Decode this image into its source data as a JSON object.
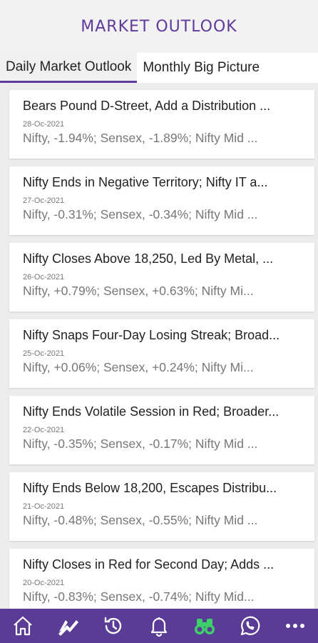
{
  "header": {
    "title": "MARKET OUTLOOK"
  },
  "tabs": [
    {
      "label": "Daily Market Outlook",
      "active": true
    },
    {
      "label": "Monthly Big Picture",
      "active": false
    }
  ],
  "items": [
    {
      "title": "Bears Pound D-Street, Add a Distribution ...",
      "date": "28-Oc-2021",
      "summary": "Nifty, -1.94%; Sensex, -1.89%; Nifty Mid ..."
    },
    {
      "title": "Nifty Ends in Negative Territory; Nifty IT a...",
      "date": "27-Oc-2021",
      "summary": "Nifty, -0.31%; Sensex, -0.34%; Nifty Mid ..."
    },
    {
      "title": "Nifty Closes Above 18,250, Led By Metal, ...",
      "date": "26-Oc-2021",
      "summary": "Nifty, +0.79%; Sensex, +0.63%; Nifty Mi..."
    },
    {
      "title": "Nifty Snaps Four-Day Losing Streak; Broad...",
      "date": "25-Oc-2021",
      "summary": "Nifty, +0.06%; Sensex, +0.24%; Nifty Mi..."
    },
    {
      "title": "Nifty Ends Volatile Session in Red; Broader...",
      "date": "22-Oc-2021",
      "summary": "Nifty, -0.35%; Sensex, -0.17%; Nifty Mid ..."
    },
    {
      "title": "Nifty Ends Below 18,200, Escapes Distribu...",
      "date": "21-Oc-2021",
      "summary": "Nifty, -0.48%; Sensex, -0.55%; Nifty Mid ..."
    },
    {
      "title": "Nifty Closes in Red for Second Day; Adds ...",
      "date": "20-Oc-2021",
      "summary": "Nifty, -0.83%; Sensex, -0.74%; Nifty Mid..."
    }
  ],
  "bottom_nav": [
    {
      "icon": "home-icon"
    },
    {
      "icon": "chart-trend-icon"
    },
    {
      "icon": "history-icon"
    },
    {
      "icon": "bell-icon"
    },
    {
      "icon": "binoculars-icon",
      "active": true
    },
    {
      "icon": "whatsapp-icon"
    },
    {
      "icon": "more-icon"
    }
  ],
  "colors": {
    "brand": "#5d3a9b",
    "nav_bg": "#5a3b96",
    "active_icon": "#3ecf6b"
  }
}
